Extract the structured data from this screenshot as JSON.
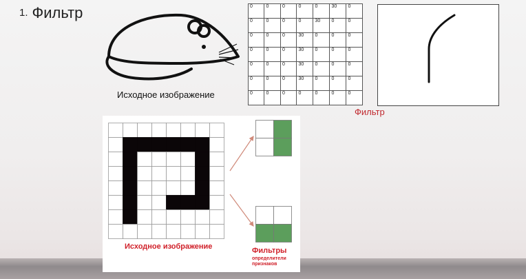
{
  "slide": {
    "number": "1.",
    "title": "Фильтр"
  },
  "mouse": {
    "caption": "Исходное изображение"
  },
  "matrix": {
    "rows": [
      [
        "0",
        "0",
        "0",
        "0",
        "0",
        "30",
        "0"
      ],
      [
        "0",
        "0",
        "0",
        "0",
        "30",
        "0",
        "0"
      ],
      [
        "0",
        "0",
        "0",
        "30",
        "0",
        "0",
        "0"
      ],
      [
        "0",
        "0",
        "0",
        "30",
        "0",
        "0",
        "0"
      ],
      [
        "0",
        "0",
        "0",
        "30",
        "0",
        "0",
        "0"
      ],
      [
        "0",
        "0",
        "0",
        "30",
        "0",
        "0",
        "0"
      ],
      [
        "0",
        "0",
        "0",
        "0",
        "0",
        "0",
        "0"
      ]
    ],
    "caption": "Фильтр"
  },
  "pixel_grid": {
    "caption": "Исходное изображение",
    "filled": [
      [
        0,
        0,
        0,
        0,
        0,
        0,
        0,
        0
      ],
      [
        0,
        1,
        1,
        1,
        1,
        1,
        1,
        0
      ],
      [
        0,
        1,
        0,
        0,
        0,
        0,
        1,
        0
      ],
      [
        0,
        1,
        0,
        0,
        0,
        0,
        1,
        0
      ],
      [
        0,
        1,
        0,
        0,
        0,
        0,
        1,
        0
      ],
      [
        0,
        1,
        0,
        0,
        1,
        1,
        1,
        0
      ],
      [
        0,
        1,
        0,
        0,
        0,
        0,
        0,
        0
      ],
      [
        0,
        0,
        0,
        0,
        0,
        0,
        0,
        0
      ]
    ]
  },
  "filters": {
    "caption": "Фильтры",
    "subcaption_line1": "определители",
    "subcaption_line2": "признаков",
    "top_filter": [
      [
        0,
        1
      ],
      [
        0,
        1
      ]
    ],
    "bottom_filter": [
      [
        0,
        0
      ],
      [
        1,
        1
      ]
    ],
    "fill_color": "#5c9e5c"
  }
}
